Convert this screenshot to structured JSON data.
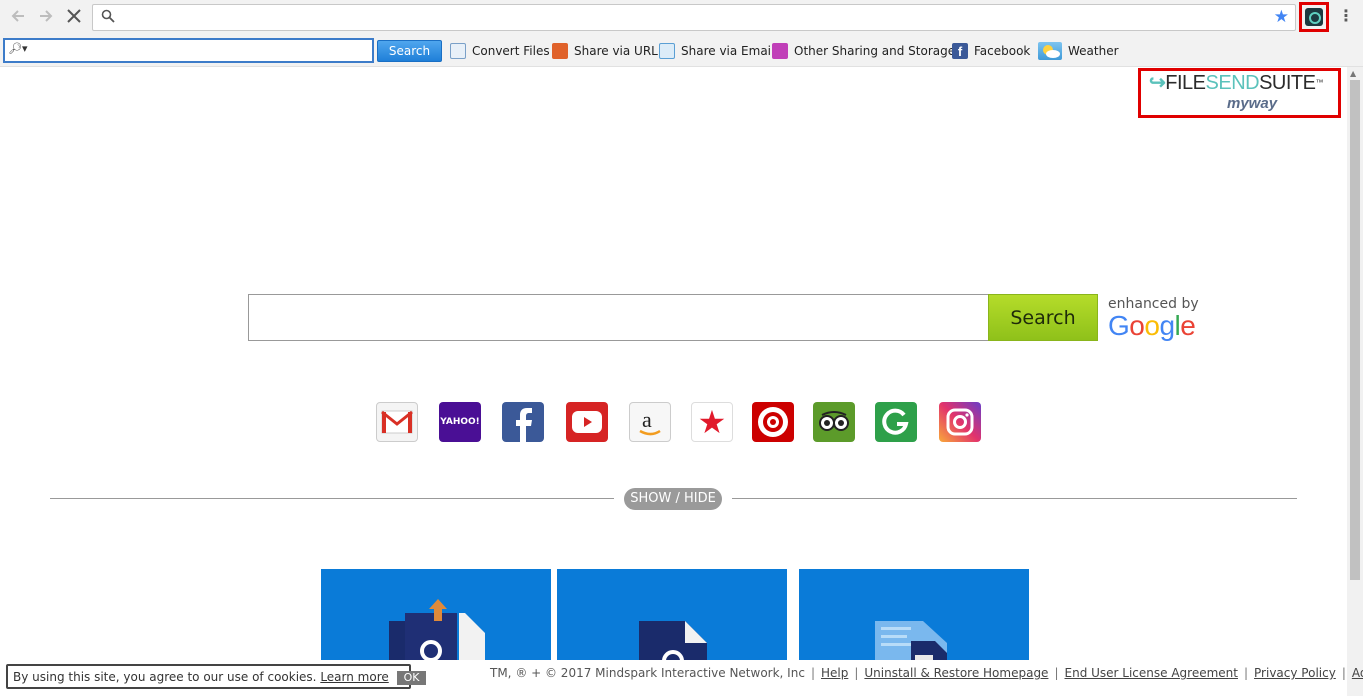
{
  "browser": {
    "back_icon": "arrow-left-icon",
    "forward_icon": "arrow-right-icon",
    "stop_icon": "close-icon",
    "address_value": "",
    "bookmark_icon": "star-icon",
    "extension_icon": "filesendsuite-extension-icon",
    "menu_icon": "kebab-menu-icon"
  },
  "toolbar": {
    "search_value": "",
    "search_button": "Search",
    "items": [
      {
        "label": "Convert Files",
        "icon": "convert-files-icon",
        "color": "#7aa0c8"
      },
      {
        "label": "Share via URL",
        "icon": "share-url-icon",
        "color": "#e0622a"
      },
      {
        "label": "Share via Email",
        "icon": "share-email-icon",
        "color": "#5a9fd4"
      },
      {
        "label": "Other Sharing and Storage",
        "icon": "storage-icon",
        "color": "#c03fb8"
      },
      {
        "label": "Facebook",
        "icon": "facebook-icon",
        "color": "#3b5998"
      },
      {
        "label": "Weather",
        "icon": "weather-icon",
        "color": "#5ab0e6"
      }
    ]
  },
  "logo": {
    "part1": "FILE",
    "part2": "SEND",
    "part3": "SUITE",
    "tm": "™",
    "by": "myway"
  },
  "main_search": {
    "value": "",
    "button": "Search",
    "enhanced_by": "enhanced by",
    "google": "Google"
  },
  "quick_links": [
    {
      "name": "gmail",
      "icon": "gmail-icon",
      "bg": "#f4f4f4"
    },
    {
      "name": "yahoo",
      "icon": "yahoo-icon",
      "bg": "#4a0f95",
      "text": "YAHOO!"
    },
    {
      "name": "facebook",
      "icon": "facebook-icon",
      "bg": "#3b5998"
    },
    {
      "name": "youtube",
      "icon": "youtube-icon",
      "bg": "#d62424"
    },
    {
      "name": "amazon",
      "icon": "amazon-icon",
      "bg": "#f7f7f7"
    },
    {
      "name": "macys",
      "icon": "macys-star-icon",
      "bg": "#ffffff"
    },
    {
      "name": "target",
      "icon": "target-icon",
      "bg": "#cc0000"
    },
    {
      "name": "tripadvisor",
      "icon": "tripadvisor-icon",
      "bg": "#5c9b2a"
    },
    {
      "name": "grammarly",
      "icon": "grammarly-icon",
      "bg": "#2ea04a"
    },
    {
      "name": "instagram",
      "icon": "instagram-icon",
      "bg": "#c13584"
    }
  ],
  "show_hide": "SHOW / HIDE",
  "footer": {
    "cookie_text": "By using this site, you agree to our use of cookies.",
    "learn_more": "Learn more",
    "ok": "OK",
    "copyright": "TM, ® + © 2017 Mindspark Interactive Network, Inc",
    "links": [
      "Help",
      "Uninstall & Restore Homepage",
      "End User License Agreement",
      "Privacy Policy",
      "AdChoices"
    ]
  }
}
